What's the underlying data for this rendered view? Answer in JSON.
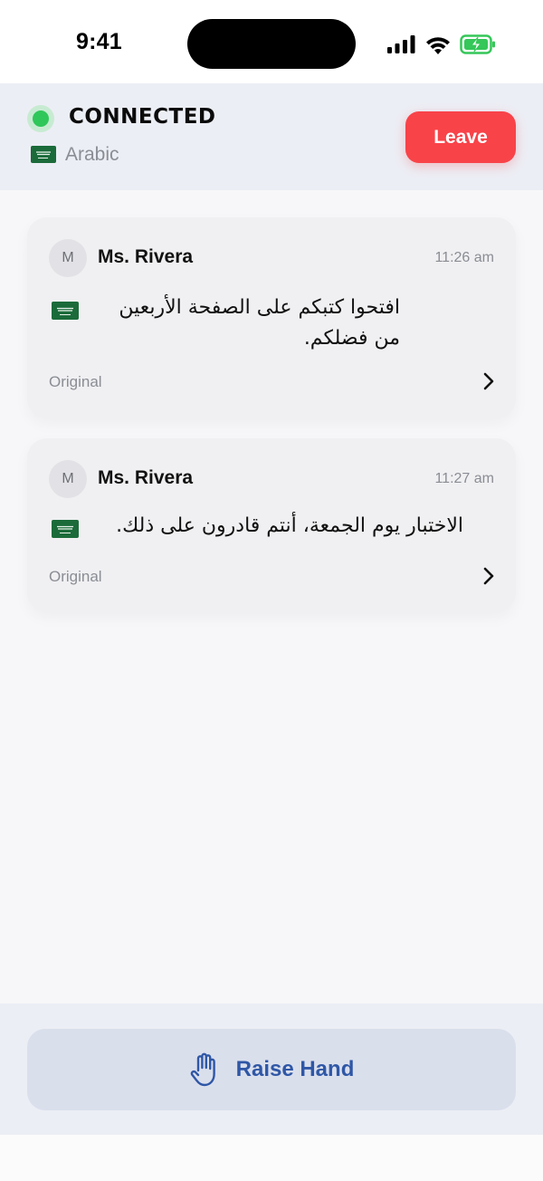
{
  "status_bar": {
    "time": "9:41"
  },
  "header": {
    "status": "CONNECTED",
    "status_color": "#2fc75a",
    "language_flag": "saudi-arabia-flag",
    "language": "Arabic",
    "leave_label": "Leave",
    "leave_color": "#f84349"
  },
  "messages": [
    {
      "avatar_initial": "M",
      "sender": "Ms. Rivera",
      "time": "11:26 am",
      "flag": "saudi-arabia-flag",
      "text": "افتحوا كتبكم على الصفحة الأربعين من فضلكم.",
      "original_label": "Original"
    },
    {
      "avatar_initial": "M",
      "sender": "Ms. Rivera",
      "time": "11:27 am",
      "flag": "saudi-arabia-flag",
      "text": "الاختبار يوم الجمعة، أنتم قادرون على ذلك.",
      "original_label": "Original"
    }
  ],
  "footer": {
    "raise_hand_label": "Raise Hand",
    "raise_hand_icon": "hand-icon",
    "accent": "#2f57a6"
  }
}
